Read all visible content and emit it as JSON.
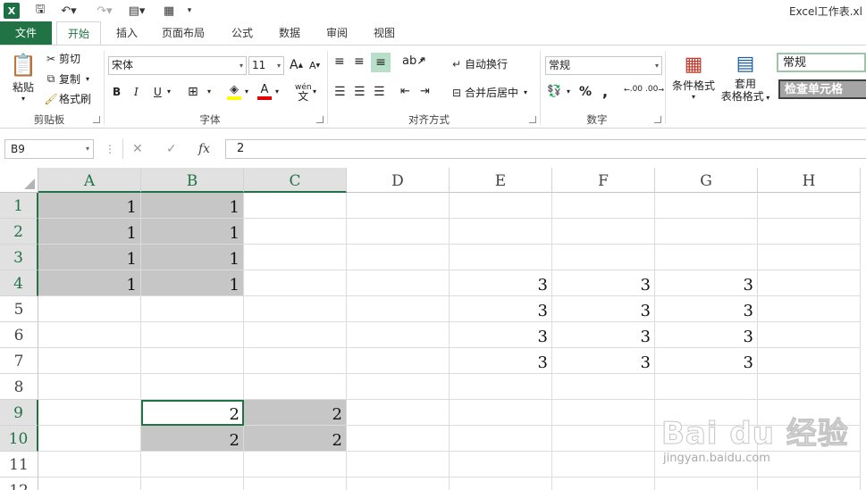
{
  "window": {
    "title": "Excel工作表.xl"
  },
  "tabs": [
    "文件",
    "开始",
    "插入",
    "页面布局",
    "公式",
    "数据",
    "审阅",
    "视图"
  ],
  "ribbon": {
    "clipboard": {
      "paste": "粘贴",
      "cut": "剪切",
      "copy": "复制",
      "format_painter": "格式刷",
      "label": "剪贴板"
    },
    "font": {
      "name": "宋体",
      "size": "11",
      "bold": "B",
      "italic": "I",
      "underline": "U",
      "grow": "A",
      "shrink": "A",
      "font_color": "A",
      "phonetic": "wén",
      "label": "字体"
    },
    "alignment": {
      "wrap_text": "自动换行",
      "merge_center": "合并后居中",
      "label": "对齐方式"
    },
    "number": {
      "format": "常规",
      "percent": "%",
      "comma": ",",
      "inc_decimal": ".00",
      "dec_decimal": ".00",
      "label": "数字"
    },
    "styles": {
      "conditional": "条件格式",
      "table_format_1": "套用",
      "table_format_2": "表格格式",
      "style_normal": "常规",
      "style_check": "检查单元格"
    }
  },
  "formula_bar": {
    "name_box": "B9",
    "cancel": "✕",
    "enter": "✓",
    "fx": "fx",
    "value": "2"
  },
  "columns": [
    "A",
    "B",
    "C",
    "D",
    "E",
    "F",
    "G",
    "H"
  ],
  "rows": [
    "1",
    "2",
    "3",
    "4",
    "5",
    "6",
    "7",
    "8",
    "9",
    "10",
    "11",
    "12"
  ],
  "cells": {
    "A1": "1",
    "B1": "1",
    "A2": "1",
    "B2": "1",
    "A3": "1",
    "B3": "1",
    "A4": "1",
    "B4": "1",
    "E4": "3",
    "F4": "3",
    "G4": "3",
    "E5": "3",
    "F5": "3",
    "G5": "3",
    "E6": "3",
    "F6": "3",
    "G6": "3",
    "E7": "3",
    "F7": "3",
    "G7": "3",
    "B9": "2",
    "C9": "2",
    "B10": "2",
    "C10": "2"
  },
  "highlighted": [
    "A1",
    "B1",
    "A2",
    "B2",
    "A3",
    "B3",
    "A4",
    "B4",
    "C9",
    "B10",
    "C10"
  ],
  "active_cell": "B9",
  "selected_columns": [
    "A",
    "B",
    "C"
  ],
  "selected_rows": [
    "1",
    "2",
    "3",
    "4",
    "9",
    "10"
  ],
  "watermark": {
    "logo": "Bai du 经验",
    "url": "jingyan.baidu.com"
  },
  "colors": {
    "accent": "#217346",
    "highlight": "#c6c6c6"
  }
}
